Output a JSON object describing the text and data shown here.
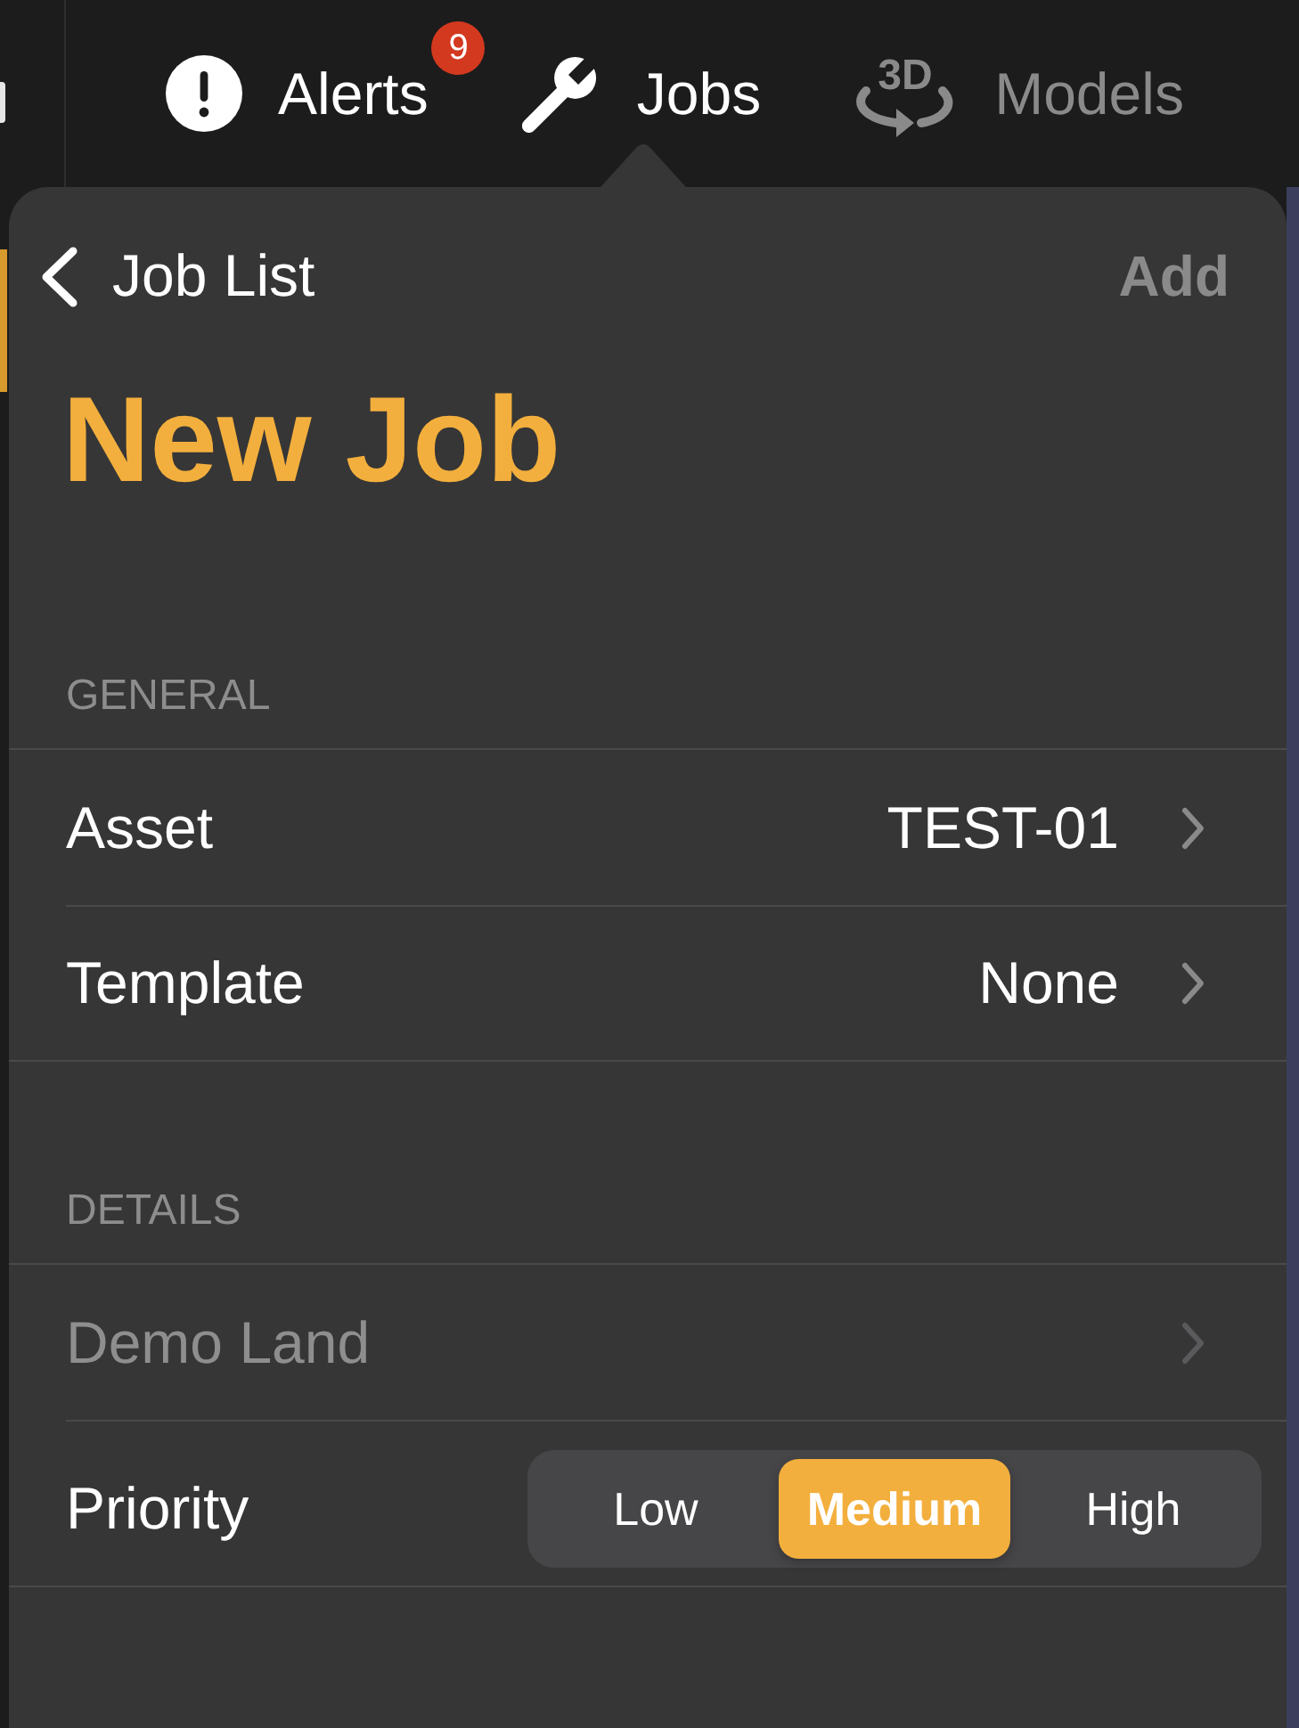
{
  "tab_bar": {
    "tabs": [
      {
        "label": "Alerts",
        "badge": "9",
        "selected": false,
        "disabled": false
      },
      {
        "label": "Jobs",
        "selected": true,
        "disabled": false
      },
      {
        "label": "Models",
        "icon_text": "3D",
        "selected": false,
        "disabled": true
      }
    ]
  },
  "popover": {
    "back": "Job List",
    "action": {
      "label": "Add",
      "disabled": true
    },
    "title": "New Job",
    "sections": [
      {
        "header": "GENERAL",
        "rows": [
          {
            "kind": "link",
            "label": "Asset",
            "value": "TEST-01",
            "disabled": false
          },
          {
            "kind": "link",
            "label": "Template",
            "value": "None",
            "disabled": false
          }
        ]
      },
      {
        "header": "DETAILS",
        "rows": [
          {
            "kind": "link",
            "label": "Demo Land",
            "disabled": true
          },
          {
            "kind": "segmented",
            "label": "Priority",
            "options": [
              {
                "label": "Low",
                "selected": false
              },
              {
                "label": "Medium",
                "selected": true
              },
              {
                "label": "High",
                "selected": false
              }
            ]
          }
        ]
      }
    ]
  }
}
